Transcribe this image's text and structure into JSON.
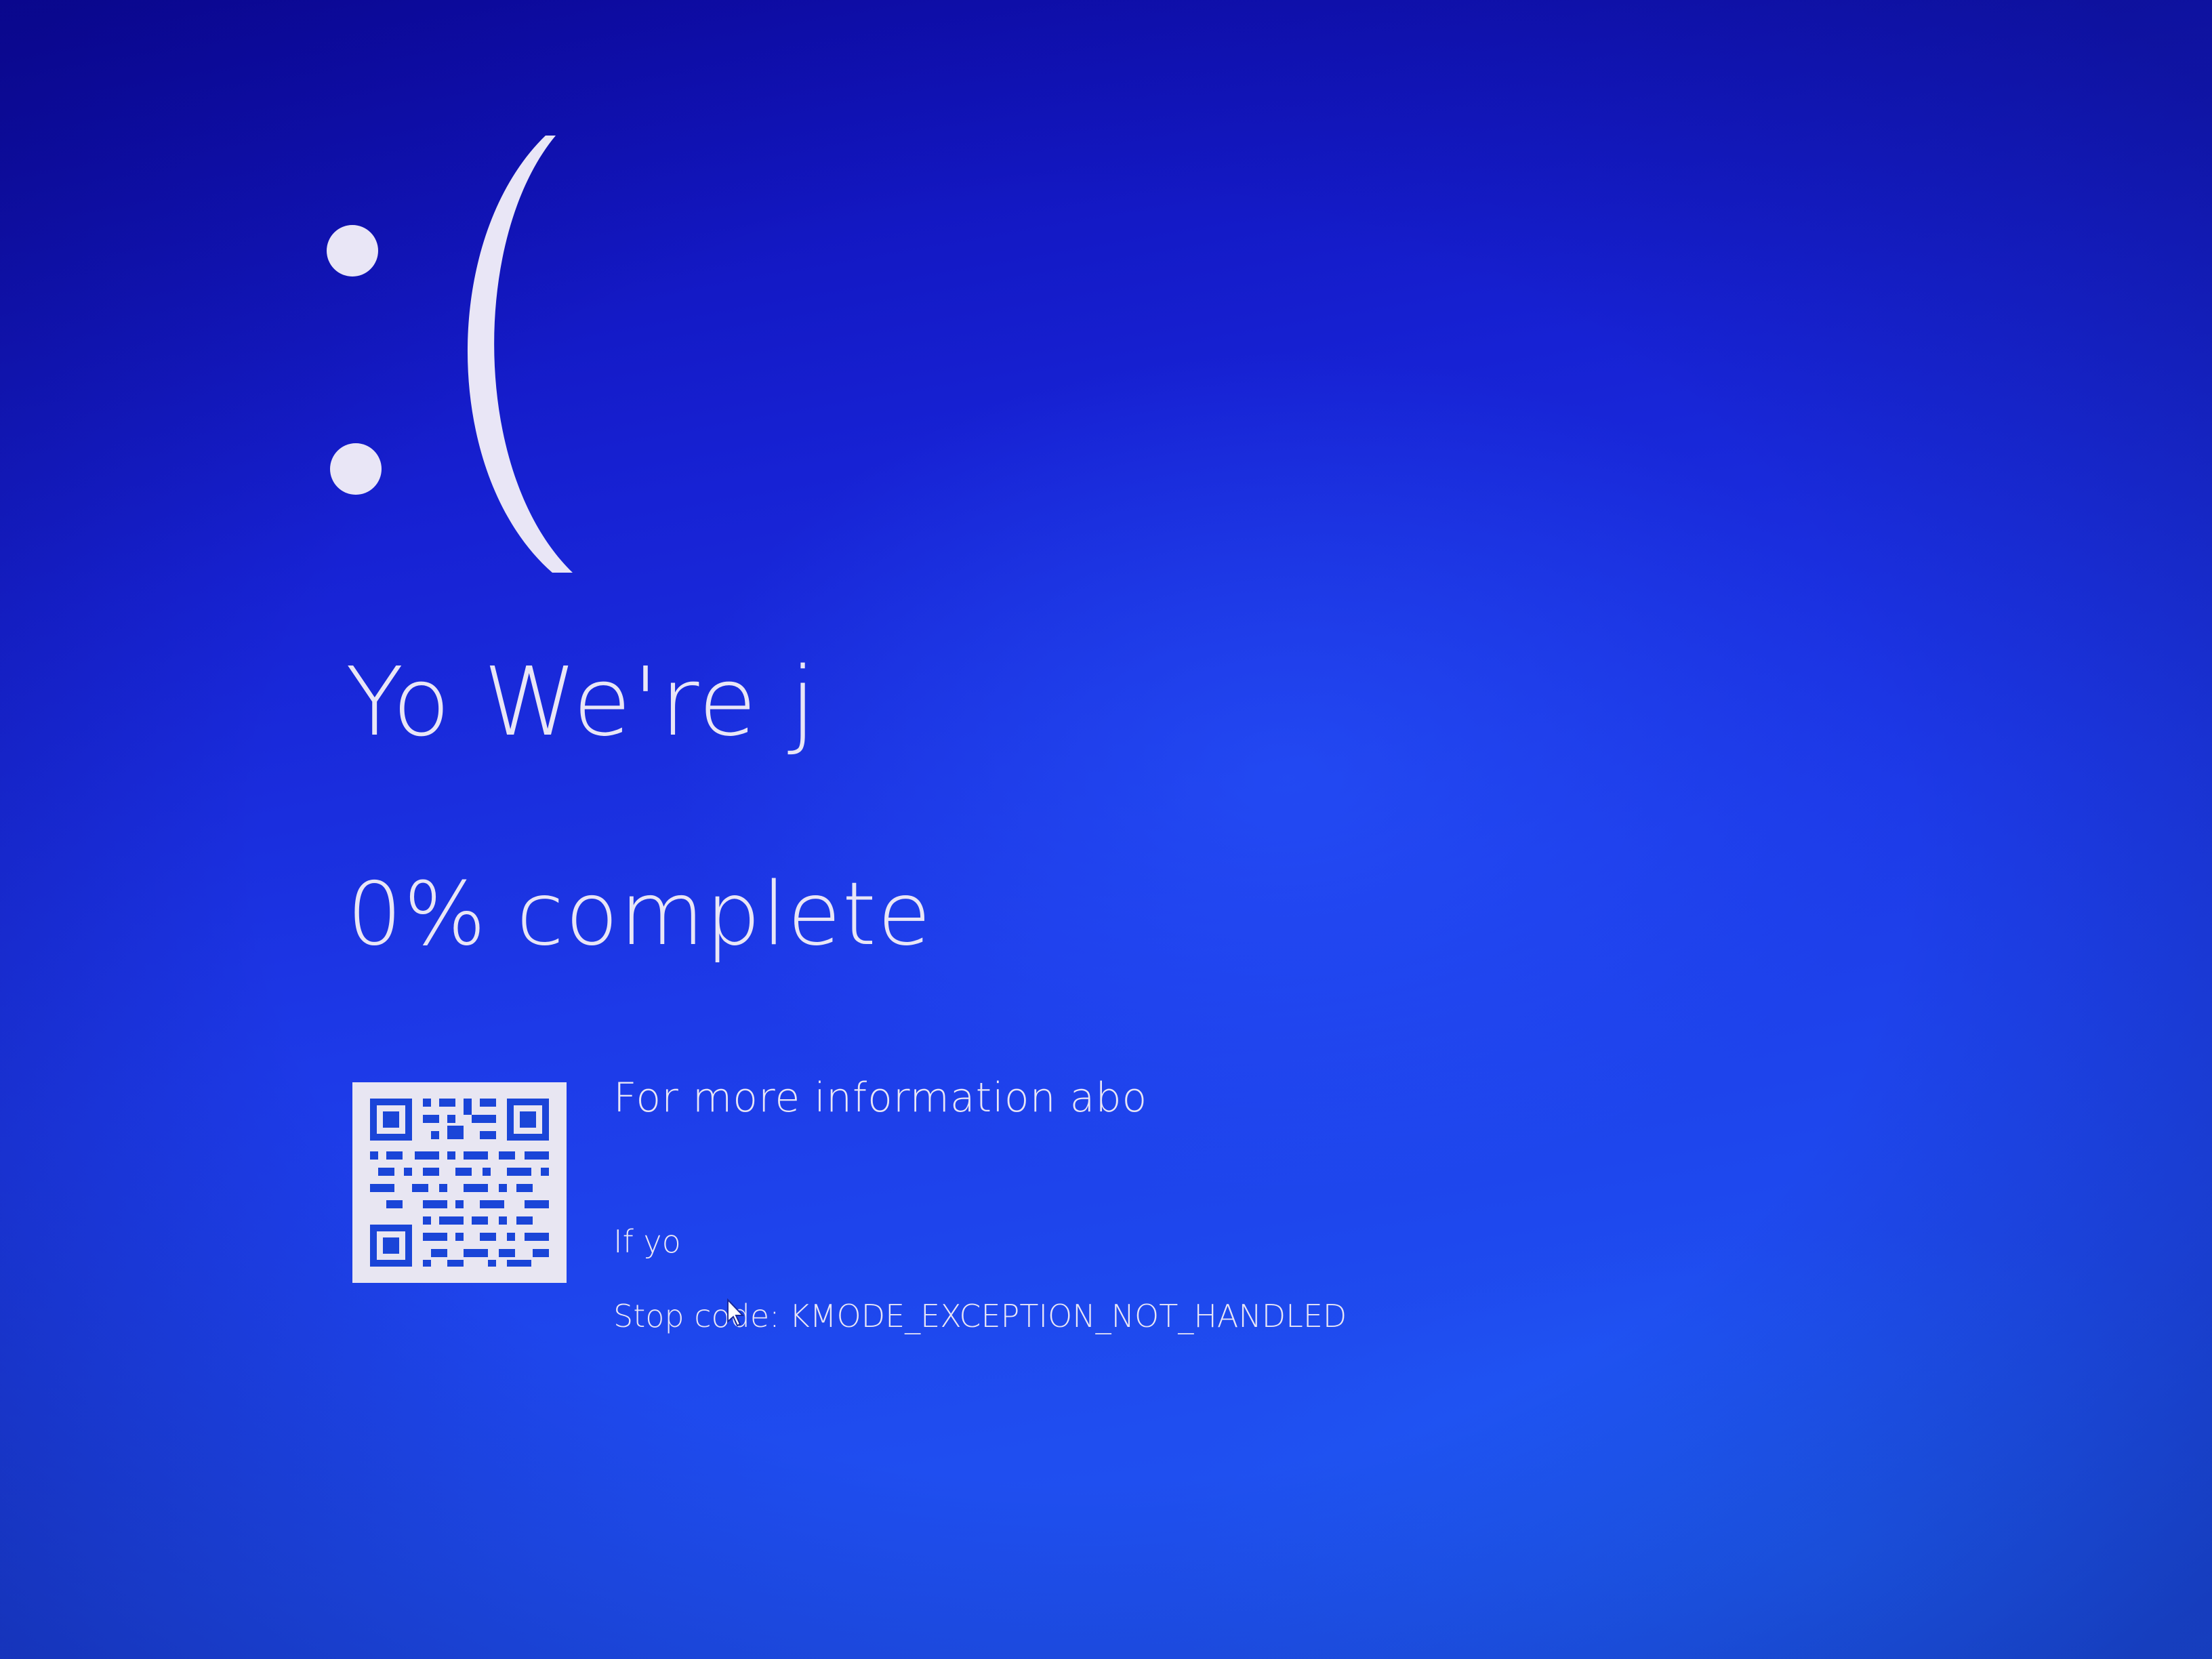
{
  "screen": {
    "background_color": "#1a35e0",
    "text_color": "#e9e6f6",
    "emoticon": ":(",
    "headline": "Yo We're j",
    "progress": {
      "percent": 0,
      "label": "0% complete"
    },
    "qr_code": {
      "icon": "qr-code-icon",
      "module_color": "#1a45d8",
      "background_color": "#e8e6f2"
    },
    "info_text": "For more information abo",
    "contact_text": "If yo",
    "stop_code": {
      "label": "Stop code:",
      "value": "KMODE_EXCEPTION_NOT_HANDLED"
    },
    "cursor_icon": "mouse-pointer-icon"
  }
}
